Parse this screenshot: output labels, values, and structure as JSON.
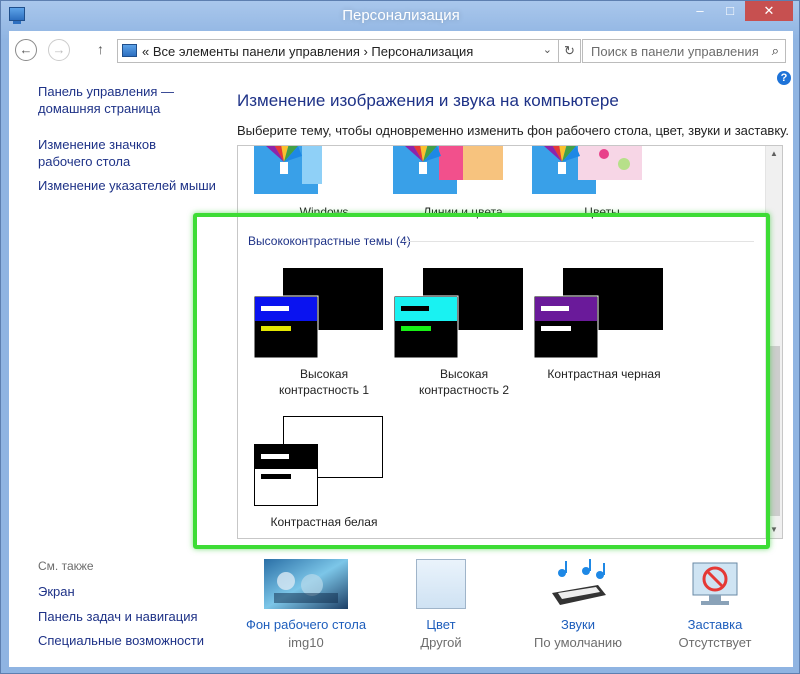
{
  "window": {
    "title": "Персонализация",
    "minimize_glyph": "–",
    "maximize_glyph": "□",
    "close_glyph": "✕"
  },
  "nav": {
    "back_glyph": "←",
    "forward_glyph": "→",
    "up_glyph": "↑",
    "address": "« Все элементы панели управления  ›  Персонализация",
    "address_dropdown_glyph": "⌄",
    "refresh_glyph": "↻",
    "search_placeholder": "Поиск в панели управления",
    "search_glyph": "⌕",
    "help_glyph": "?"
  },
  "sidebar": {
    "home_link": [
      "Панель управления —",
      "домашняя страница"
    ],
    "items": [
      [
        "Изменение значков",
        "рабочего стола"
      ],
      [
        "Изменение указателей мыши"
      ]
    ],
    "see_also_label": "См. также",
    "see_also": [
      "Экран",
      "Панель задач и навигация",
      "Специальные возможности"
    ]
  },
  "main": {
    "heading": "Изменение изображения и звука на компьютере",
    "description": "Выберите тему, чтобы одновременно изменить фон рабочего стола, цвет, звуки и заставку."
  },
  "themes": {
    "top_row": [
      "Windows",
      "Линии и цвета",
      "Цветы"
    ],
    "group_title": "Высококонтрастные темы (4)",
    "high_contrast": [
      {
        "label": [
          "Высокая",
          "контрастность 1"
        ],
        "title_color": "#0a13f0",
        "accent_color": "#e2e600"
      },
      {
        "label": [
          "Высокая",
          "контрастность 2"
        ],
        "title_color": "#19f2f2",
        "accent_color": "#17f016"
      },
      {
        "label": [
          "Контрастная черная"
        ],
        "title_color": "#6a1a9a",
        "accent_color": "#ffffff"
      },
      {
        "label": [
          "Контрастная белая"
        ],
        "title_color": "#000000",
        "accent_color": "#000000"
      }
    ],
    "scroll_up_glyph": "▲",
    "scroll_down_glyph": "▼"
  },
  "bottom": [
    {
      "link": "Фон рабочего стола",
      "sub": "img10"
    },
    {
      "link": "Цвет",
      "sub": "Другой"
    },
    {
      "link": "Звуки",
      "sub": "По умолчанию"
    },
    {
      "link": "Заставка",
      "sub": "Отсутствует"
    }
  ],
  "colors": {
    "accent_highlight": "#3ddc35",
    "link": "#1e3287"
  }
}
